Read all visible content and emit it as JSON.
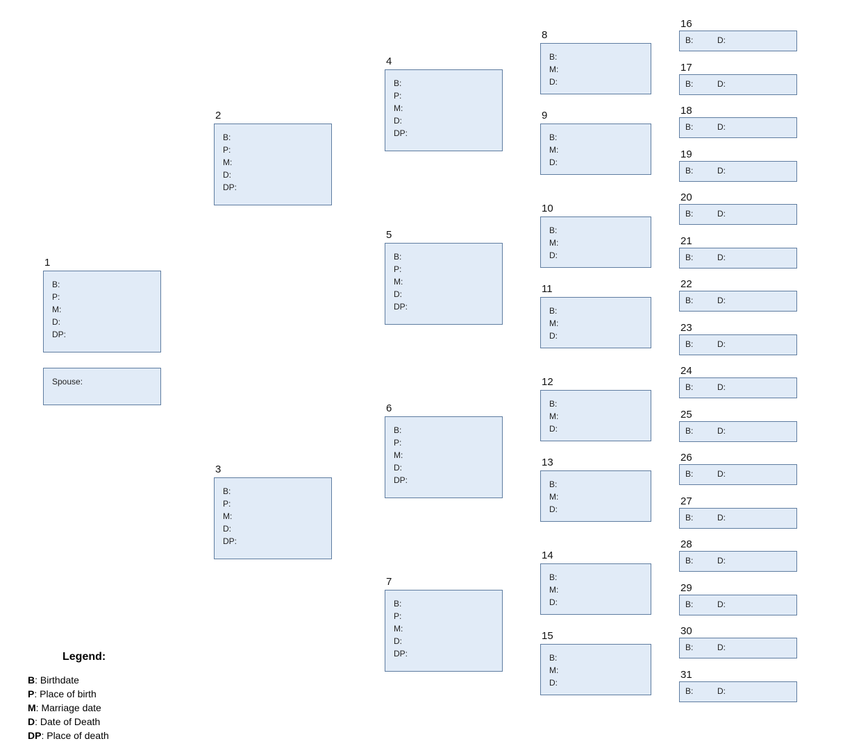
{
  "labels": {
    "B": "B:",
    "P": "P:",
    "M": "M:",
    "D": "D:",
    "DP": "DP:",
    "Spouse": "Spouse:"
  },
  "legend": {
    "title": "Legend:",
    "items": [
      {
        "abbr": "B",
        "text": ": Birthdate"
      },
      {
        "abbr": "P",
        "text": ": Place of birth"
      },
      {
        "abbr": "M",
        "text": ": Marriage date"
      },
      {
        "abbr": "D",
        "text": ": Date of Death"
      },
      {
        "abbr": "DP",
        "text": ": Place of death"
      }
    ]
  },
  "boxes": {
    "col1": {
      "main": {
        "num": "1",
        "fields": [
          "B",
          "P",
          "M",
          "D",
          "DP"
        ]
      },
      "spouse": {
        "fields": [
          "Spouse"
        ]
      }
    },
    "col2": [
      {
        "num": "2",
        "fields": [
          "B",
          "P",
          "M",
          "D",
          "DP"
        ]
      },
      {
        "num": "3",
        "fields": [
          "B",
          "P",
          "M",
          "D",
          "DP"
        ]
      }
    ],
    "col3": [
      {
        "num": "4",
        "fields": [
          "B",
          "P",
          "M",
          "D",
          "DP"
        ]
      },
      {
        "num": "5",
        "fields": [
          "B",
          "P",
          "M",
          "D",
          "DP"
        ]
      },
      {
        "num": "6",
        "fields": [
          "B",
          "P",
          "M",
          "D",
          "DP"
        ]
      },
      {
        "num": "7",
        "fields": [
          "B",
          "P",
          "M",
          "D",
          "DP"
        ]
      }
    ],
    "col4": [
      {
        "num": "8",
        "fields": [
          "B",
          "M",
          "D"
        ]
      },
      {
        "num": "9",
        "fields": [
          "B",
          "M",
          "D"
        ]
      },
      {
        "num": "10",
        "fields": [
          "B",
          "M",
          "D"
        ]
      },
      {
        "num": "11",
        "fields": [
          "B",
          "M",
          "D"
        ]
      },
      {
        "num": "12",
        "fields": [
          "B",
          "M",
          "D"
        ]
      },
      {
        "num": "13",
        "fields": [
          "B",
          "M",
          "D"
        ]
      },
      {
        "num": "14",
        "fields": [
          "B",
          "M",
          "D"
        ]
      },
      {
        "num": "15",
        "fields": [
          "B",
          "M",
          "D"
        ]
      }
    ],
    "col5": [
      {
        "num": "16"
      },
      {
        "num": "17"
      },
      {
        "num": "18"
      },
      {
        "num": "19"
      },
      {
        "num": "20"
      },
      {
        "num": "21"
      },
      {
        "num": "22"
      },
      {
        "num": "23"
      },
      {
        "num": "24"
      },
      {
        "num": "25"
      },
      {
        "num": "26"
      },
      {
        "num": "27"
      },
      {
        "num": "28"
      },
      {
        "num": "29"
      },
      {
        "num": "30"
      },
      {
        "num": "31"
      }
    ]
  }
}
